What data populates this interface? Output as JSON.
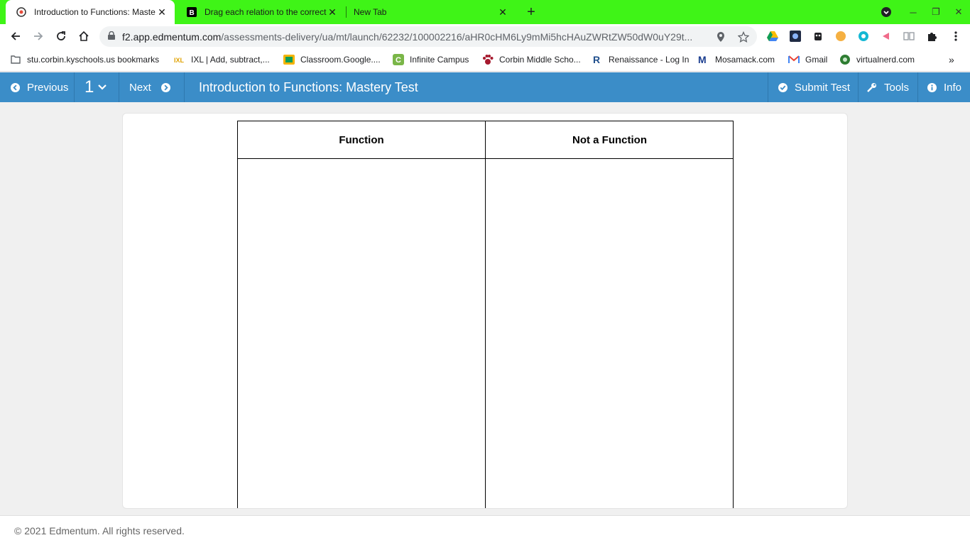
{
  "browser": {
    "tabs": [
      {
        "title": "Introduction to Functions: Maste",
        "active": true
      },
      {
        "title": "Drag each relation to the correct",
        "active": false
      },
      {
        "title": "New Tab",
        "active": false
      }
    ],
    "url_host": "f2.app.edmentum.com",
    "url_path": "/assessments-delivery/ua/mt/launch/62232/100002216/aHR0cHM6Ly9mMi5hcHAuZWRtZW50dW0uY29t...",
    "tabstrip_color": "#3ff417"
  },
  "bookmarks": [
    {
      "label": "stu.corbin.kyschools.us bookmarks",
      "icon": "folder-icon"
    },
    {
      "label": "IXL | Add, subtract,...",
      "icon": "ixl-icon"
    },
    {
      "label": "Classroom.Google....",
      "icon": "classroom-icon"
    },
    {
      "label": "Infinite Campus",
      "icon": "campus-icon"
    },
    {
      "label": "Corbin Middle Scho...",
      "icon": "paw-icon"
    },
    {
      "label": "Renaissance - Log In",
      "icon": "renaissance-icon"
    },
    {
      "label": "Mosamack.com",
      "icon": "mosamack-icon"
    },
    {
      "label": "Gmail",
      "icon": "gmail-icon"
    },
    {
      "label": "virtualnerd.com",
      "icon": "virtualnerd-icon"
    }
  ],
  "app": {
    "previous_label": "Previous",
    "question_number": "1",
    "next_label": "Next",
    "title": "Introduction to Functions: Mastery Test",
    "submit_label": "Submit Test",
    "tools_label": "Tools",
    "info_label": "Info",
    "accent": "#3b8dc8"
  },
  "table": {
    "headers": [
      "Function",
      "Not a Function"
    ]
  },
  "footer": {
    "copyright": "© 2021 Edmentum. All rights reserved."
  }
}
